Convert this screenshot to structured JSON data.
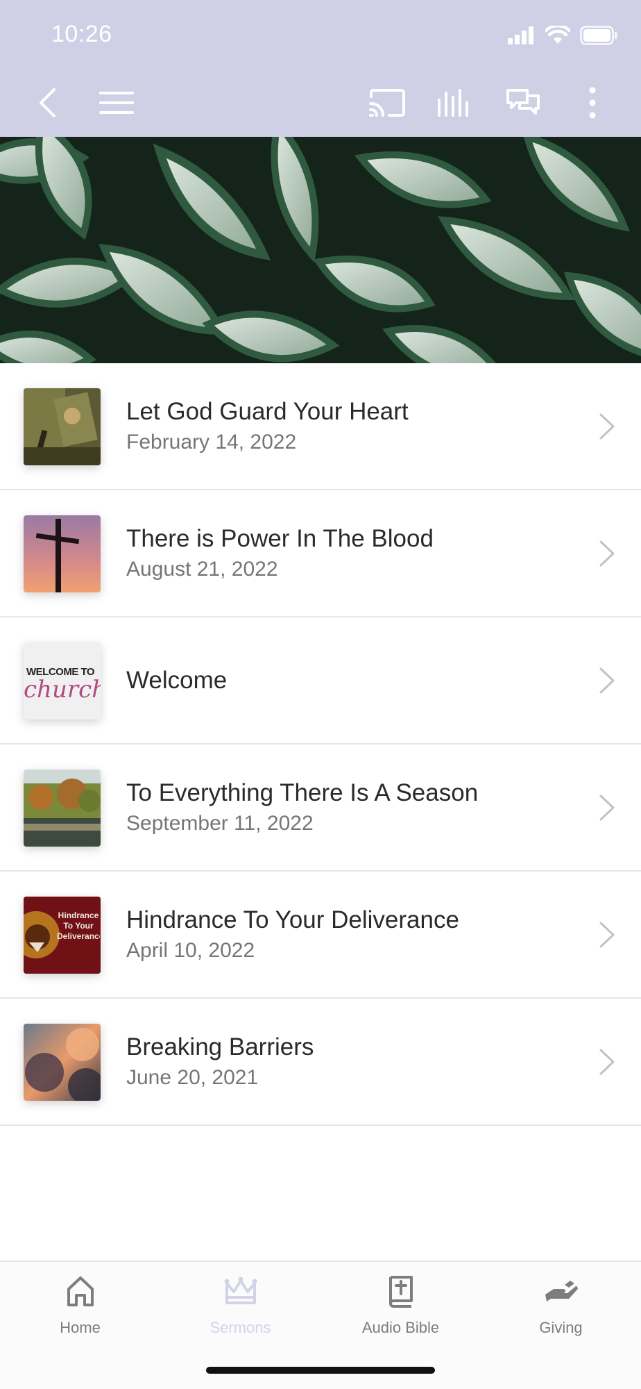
{
  "status_bar": {
    "time": "10:26"
  },
  "nav": {
    "back_icon": "chevron-left-icon",
    "menu_icon": "hamburger-icon",
    "cast_icon": "cast-icon",
    "audio_icon": "audio-bars-icon",
    "chat_icon": "chat-icon",
    "more_icon": "more-vertical-icon"
  },
  "sermons": [
    {
      "title": "Let God Guard Your Heart",
      "date": "February 14, 2022"
    },
    {
      "title": "There is Power In The Blood",
      "date": "August 21, 2022"
    },
    {
      "title": "Welcome",
      "date": ""
    },
    {
      "title": "To Everything There Is A Season",
      "date": "September 11, 2022"
    },
    {
      "title": "Hindrance To Your Deliverance",
      "date": "April 10, 2022"
    },
    {
      "title": "Breaking Barriers",
      "date": "June 20, 2021"
    }
  ],
  "thumb_text": {
    "welcome_top": "WELCOME TO",
    "welcome_bottom": "church",
    "hindrance": "Hindrance To Your Deliverance"
  },
  "tabs": [
    {
      "label": "Home",
      "icon": "home-icon",
      "active": false
    },
    {
      "label": "Sermons",
      "icon": "crown-icon",
      "active": true
    },
    {
      "label": "Audio Bible",
      "icon": "bible-icon",
      "active": false
    },
    {
      "label": "Giving",
      "icon": "giving-hand-icon",
      "active": false
    }
  ],
  "colors": {
    "header_bg": "#cfd0e5",
    "active_tab": "#d3d3e8",
    "inactive_tab": "#7d7d7d"
  }
}
